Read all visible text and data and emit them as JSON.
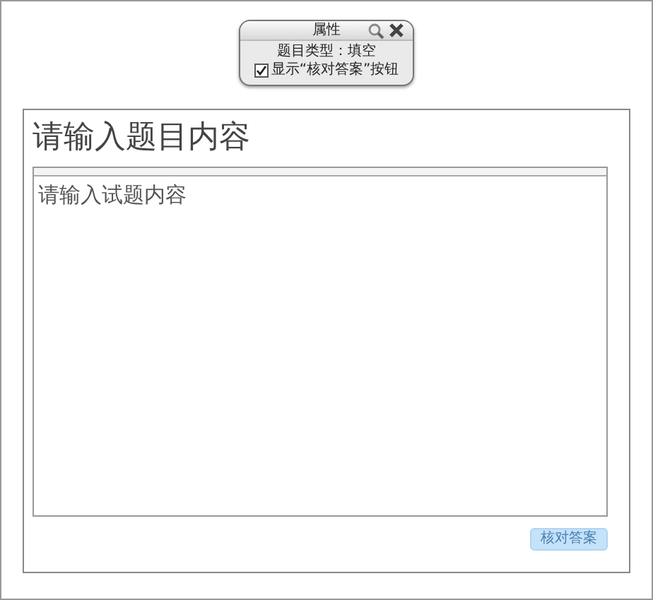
{
  "properties_panel": {
    "title": "属性",
    "question_type_label": "题目类型：填空",
    "show_check_answer": {
      "label": "显示“核对答案”按钮",
      "checked": true
    }
  },
  "question": {
    "title": "请输入题目内容",
    "content": "请输入试题内容"
  },
  "check_answer_button": {
    "label": "核对答案",
    "disabled": true
  }
}
